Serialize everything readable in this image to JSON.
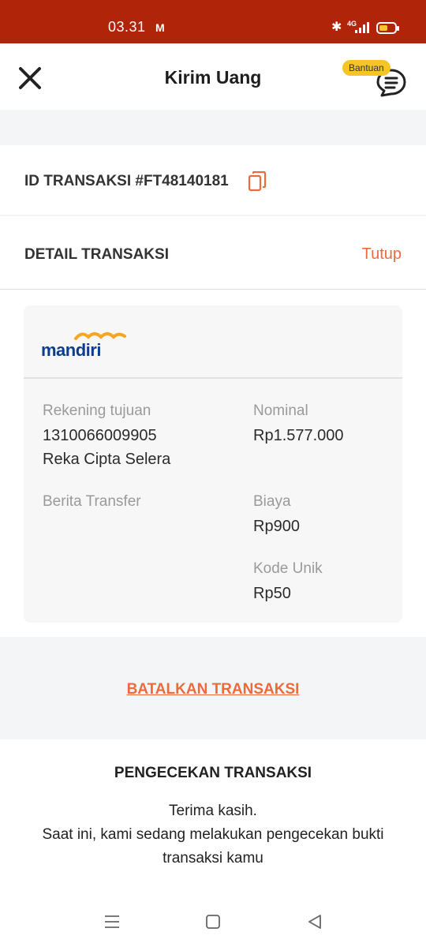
{
  "status_bar": {
    "time": "03.31",
    "gmail_icon": "M",
    "network": "4G"
  },
  "header": {
    "title": "Kirim Uang",
    "help_label": "Bantuan"
  },
  "transaction": {
    "id_label": "ID TRANSAKSI #FT48140181"
  },
  "detail": {
    "title": "DETAIL TRANSAKSI",
    "close_label": "Tutup",
    "bank_name": "mandiri",
    "account_label": "Rekening tujuan",
    "account_number": "1310066009905",
    "account_name": "Reka Cipta Selera",
    "note_label": "Berita Transfer",
    "amount_label": "Nominal",
    "amount_value": "Rp1.577.000",
    "fee_label": "Biaya",
    "fee_value": "Rp900",
    "unique_code_label": "Kode Unik",
    "unique_code_value": "Rp50"
  },
  "actions": {
    "cancel_label": "BATALKAN TRANSAKSI"
  },
  "check": {
    "title": "PENGECEKAN TRANSAKSI",
    "line1": "Terima kasih.",
    "line2": "Saat ini, kami sedang melakukan pengecekan bukti transaksi kamu"
  },
  "colors": {
    "status_bar": "#b0240a",
    "accent": "#ee6a3c",
    "badge": "#f6c427",
    "mandiri_blue": "#0d3d8c",
    "mandiri_gold": "#f5a623"
  },
  "icons": [
    "close-icon",
    "chat-icon",
    "copy-icon",
    "bluetooth-icon",
    "signal-icon",
    "battery-icon",
    "menu-icon",
    "home-icon",
    "back-icon"
  ]
}
